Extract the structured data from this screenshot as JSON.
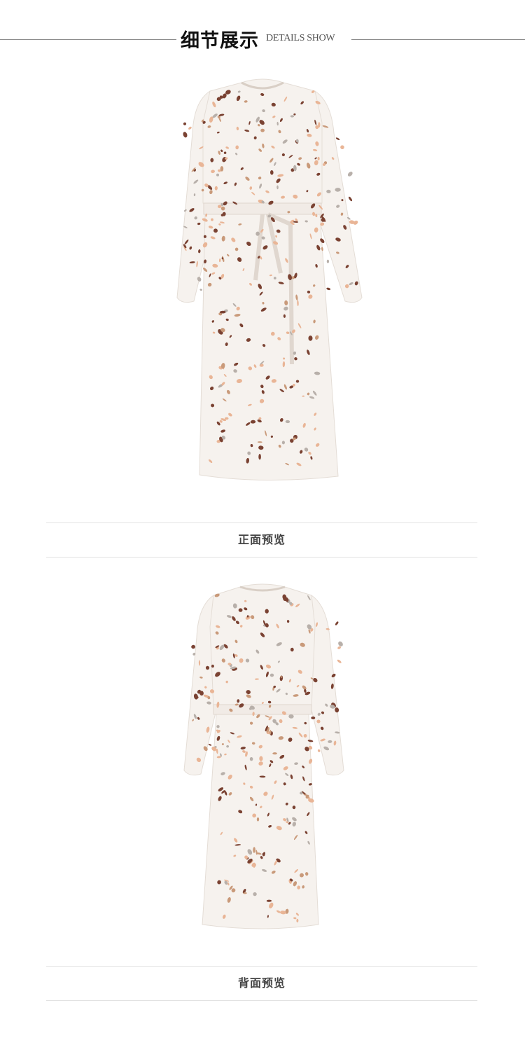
{
  "header": {
    "title_cn": "细节展示",
    "title_en": "DETAILS SHOW"
  },
  "front_view": {
    "caption": "正面预览",
    "image_alt": "front-view-dress-photo"
  },
  "back_view": {
    "caption": "背面预览",
    "image_alt": "back-view-dress-photo"
  },
  "colors": {
    "fabric": "#f6f2ee",
    "speck_brown": "#7a4232",
    "speck_peach": "#e9b596",
    "speck_grey": "#b8b0aa",
    "speck_tan": "#c99a7a"
  }
}
